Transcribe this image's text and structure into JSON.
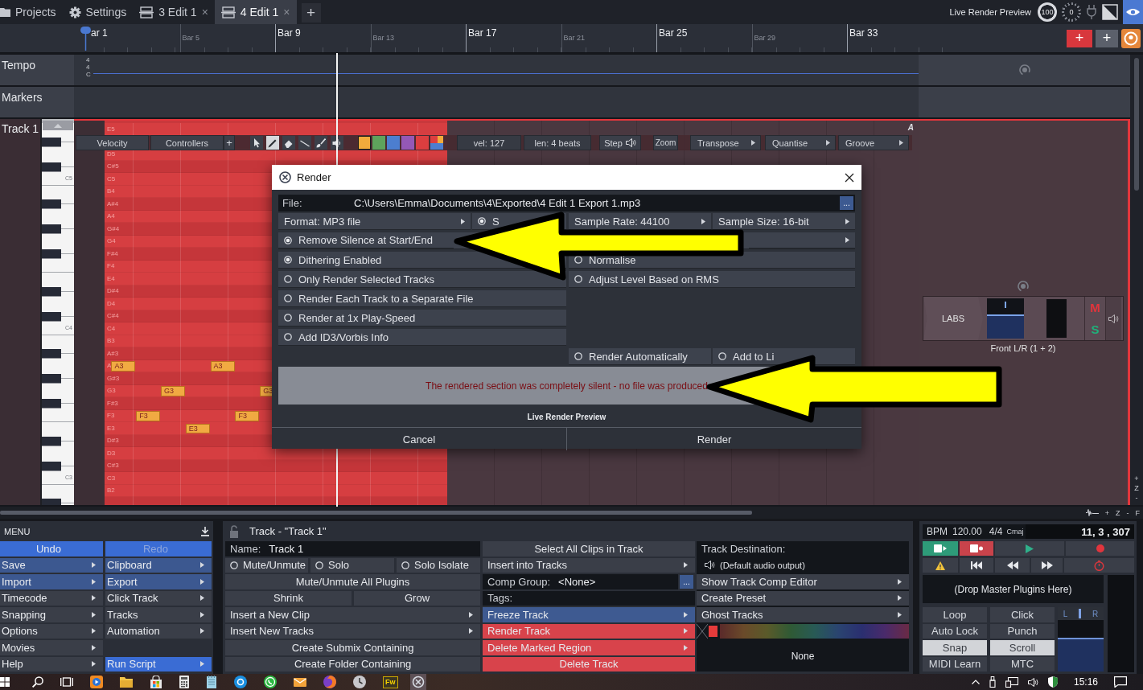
{
  "tabs": [
    {
      "kind": "folder",
      "label": "Projects",
      "selected": false
    },
    {
      "kind": "gear",
      "label": "Settings",
      "selected": false
    },
    {
      "kind": "edit",
      "label": "3 Edit 1",
      "close": "×",
      "selected": false
    },
    {
      "kind": "edit",
      "label": "4 Edit 1",
      "close": "×",
      "selected": true
    }
  ],
  "new_tab": "+",
  "live_render": {
    "label": "Live Render Preview",
    "knobs": [
      {
        "kind": "solid",
        "reading": "100"
      },
      {
        "kind": "dotted",
        "reading": "0"
      }
    ]
  },
  "ruler": {
    "bars": [
      {
        "label": "ar 1",
        "major": true
      },
      {
        "label": "Bar 5",
        "major": false
      },
      {
        "label": "Bar 9",
        "major": true
      },
      {
        "label": "Bar 13",
        "major": false
      },
      {
        "label": "Bar 17",
        "major": true
      },
      {
        "label": "Bar 21",
        "major": false
      },
      {
        "label": "Bar 25",
        "major": true
      },
      {
        "label": "Bar 29",
        "major": false
      },
      {
        "label": "Bar 33",
        "major": true
      }
    ],
    "buttons": [
      {
        "kind": "accent",
        "label": "+"
      },
      {
        "kind": "plain",
        "label": "+"
      }
    ]
  },
  "tempo_track": {
    "name": "Tempo",
    "signature": [
      "4",
      "4",
      "C"
    ]
  },
  "marker_track": {
    "name": "Markers"
  },
  "midi_track": {
    "name": "Track 1",
    "rows": [
      {
        "note": "E5",
        "black": false
      },
      {
        "black": true
      },
      {
        "note": "D5",
        "black": false
      },
      {
        "note": "C#5",
        "black": true
      },
      {
        "note": "C5",
        "black": false,
        "key_label": "C5"
      },
      {
        "note": "B4",
        "black": false
      },
      {
        "note": "A#4",
        "black": true
      },
      {
        "note": "A4",
        "black": false
      },
      {
        "note": "G#4",
        "black": true
      },
      {
        "note": "G4",
        "black": false
      },
      {
        "note": "F#4",
        "black": true
      },
      {
        "note": "F4",
        "black": false
      },
      {
        "note": "E4",
        "black": false
      },
      {
        "note": "D#4",
        "black": true
      },
      {
        "note": "D4",
        "black": false
      },
      {
        "note": "C#4",
        "black": true
      },
      {
        "note": "C4",
        "black": false,
        "key_label": "C4"
      },
      {
        "note": "B3",
        "black": false
      },
      {
        "note": "A#3",
        "black": true
      },
      {
        "note": "A",
        "black": false,
        "notes": [
          {
            "label": "A3"
          },
          {
            "label": "A3"
          }
        ]
      },
      {
        "note": "G#3",
        "black": true
      },
      {
        "note": "G3",
        "black": false,
        "notes": [
          {
            "label": "G3"
          },
          {
            "label": "G3"
          }
        ]
      },
      {
        "note": "F#3",
        "black": true
      },
      {
        "note": "F3",
        "black": false,
        "notes": [
          {
            "label": "F3"
          },
          {
            "label": "F3"
          }
        ]
      },
      {
        "note": "E3",
        "black": false,
        "notes": [
          {
            "label": "E3"
          }
        ]
      },
      {
        "note": "D#3",
        "black": true
      },
      {
        "note": "D3",
        "black": false
      },
      {
        "note": "C#3",
        "black": true
      },
      {
        "note": "C3",
        "black": false,
        "key_label": "C3"
      },
      {
        "note": "B2",
        "black": false
      },
      {
        "black": true
      }
    ],
    "toolbar": {
      "buttons": [
        "Velocity",
        "Controllers"
      ],
      "add": "+",
      "tools": [
        {
          "selected": false
        },
        {
          "selected": true
        },
        {
          "selected": false
        },
        {
          "selected": false
        },
        {
          "selected": false
        },
        {
          "selected": false
        }
      ],
      "swatches": [
        {
          "color": "#f2ab3c",
          "selected": true
        },
        {
          "color": "#5ea35c",
          "selected": false
        },
        {
          "color": "#4c7ecf",
          "selected": false
        },
        {
          "color": "#9458b6",
          "selected": false
        },
        {
          "color": "#dc3e3f",
          "selected": false
        },
        {
          "kind": "multi",
          "selected": false
        }
      ],
      "readouts": [
        "vel: 127",
        "len: 4 beats"
      ],
      "step": "Step",
      "zoom": "Zoom",
      "menus": [
        "Transpose",
        "Quantise",
        "Groove"
      ]
    },
    "corner": "A",
    "mixer": {
      "plugin": "LABS",
      "level": 0.6,
      "mute": "M",
      "solo": "S",
      "output": "Front L/R (1 + 2)"
    }
  },
  "zoom_controls": {
    "vertical": [
      "+",
      "Z",
      "-"
    ],
    "horizontal": [
      "+",
      "Z",
      "-",
      "F"
    ]
  },
  "render_dialog": {
    "title": "Render",
    "file_label": "File:",
    "file_path": "C:\\Users\\Emma\\Documents\\4\\Exported\\4 Edit 1 Export 1.mp3",
    "browse": "...",
    "rows": [
      {
        "left": [
          {
            "kind": "dropdown",
            "label": "Format: MP3 file"
          },
          {
            "kind": "radio",
            "label": "S",
            "checked": true
          }
        ],
        "right": [
          {
            "kind": "dropdown",
            "label": "Sample Rate: 44100"
          },
          {
            "kind": "dropdown",
            "label": "Sample Size: 16-bit"
          }
        ]
      },
      {
        "left": [
          {
            "kind": "radio",
            "label": "Remove Silence at Start/End",
            "checked": true
          }
        ],
        "right": [
          {
            "kind": "dropdown"
          }
        ]
      },
      {
        "left": [
          {
            "kind": "radio",
            "label": "Dithering Enabled",
            "checked": true
          }
        ],
        "right": [
          {
            "kind": "radio",
            "label": "Normalise",
            "checked": false
          }
        ]
      },
      {
        "left": [
          {
            "kind": "radio",
            "label": "Only Render Selected Tracks",
            "checked": false
          }
        ],
        "right": [
          {
            "kind": "radio",
            "label": "Adjust Level Based on RMS",
            "checked": false
          }
        ]
      },
      {
        "left": [
          {
            "kind": "radio",
            "label": "Render Each Track to a Separate File",
            "checked": false
          }
        ]
      },
      {
        "left": [
          {
            "kind": "radio",
            "label": "Render at 1x Play-Speed",
            "checked": false
          }
        ]
      },
      {
        "left": [
          {
            "kind": "radio",
            "label": "Add ID3/Vorbis Info",
            "checked": false
          }
        ]
      },
      {
        "right": [
          {
            "kind": "radio",
            "label": "Render Automatically",
            "checked": false
          },
          {
            "kind": "radio",
            "label": "Add to Li",
            "checked": false
          }
        ]
      }
    ],
    "message": "The rendered section was completely silent - no file was produced",
    "preview_label": "Live Render Preview",
    "buttons": [
      "Cancel",
      "Render"
    ]
  },
  "menu": {
    "title": "MENU",
    "items": [
      {
        "label": "Undo",
        "color": "#3a6cd4",
        "submenu": false,
        "disabled": false
      },
      {
        "label": "Redo",
        "color": "#3a6cd4",
        "submenu": false,
        "disabled": true
      },
      {
        "label": "Save",
        "color": "#3c5890",
        "submenu": true,
        "disabled": false
      },
      {
        "label": "Clipboard",
        "color": "#3c5890",
        "submenu": true,
        "disabled": false
      },
      {
        "label": "Import",
        "color": "#3c5890",
        "submenu": true,
        "disabled": false
      },
      {
        "label": "Export",
        "color": "#3c5890",
        "submenu": true,
        "disabled": false
      },
      {
        "label": "Timecode",
        "submenu": true,
        "disabled": false
      },
      {
        "label": "Click Track",
        "submenu": true,
        "disabled": false
      },
      {
        "label": "Snapping",
        "submenu": true,
        "disabled": false
      },
      {
        "label": "Tracks",
        "submenu": true,
        "disabled": false
      },
      {
        "label": "Options",
        "submenu": true,
        "disabled": false
      },
      {
        "label": "Automation",
        "submenu": true,
        "disabled": false
      },
      {
        "label": "Movies",
        "submenu": true,
        "disabled": false
      },
      {
        "kind": "empty"
      },
      {
        "label": "Help",
        "submenu": true,
        "disabled": false
      },
      {
        "label": "Run Script",
        "color": "#3a6cd4",
        "submenu": true,
        "disabled": false
      }
    ]
  },
  "track_panel": {
    "title": "Track - \"Track 1\"",
    "columns": [
      [
        {
          "kind": "field",
          "label": "Name:",
          "value": "Track 1"
        },
        {
          "kind": "radios",
          "items": [
            {
              "label": "Mute/Unmute",
              "checked": false
            },
            {
              "label": "Solo",
              "checked": false
            },
            {
              "label": "Solo Isolate",
              "checked": false
            }
          ]
        },
        {
          "kind": "button",
          "label": "Mute/Unmute All Plugins"
        },
        {
          "kind": "pair",
          "items": [
            "Shrink",
            "Grow"
          ]
        },
        {
          "kind": "menu",
          "label": "Insert a New Clip"
        },
        {
          "kind": "menu",
          "label": "Insert New Tracks"
        },
        {
          "kind": "button",
          "label": "Create Submix Containing"
        },
        {
          "kind": "button",
          "label": "Create Folder Containing"
        }
      ],
      [
        {
          "kind": "button",
          "label": "Select All Clips in Track"
        },
        {
          "kind": "menu",
          "label": "Insert into Tracks"
        },
        {
          "kind": "field",
          "label": "Comp Group:",
          "value": "<None>",
          "browse": "..."
        },
        {
          "kind": "field",
          "label": "Tags:"
        },
        {
          "kind": "menu",
          "label": "Freeze Track",
          "color": "#3e5a91"
        },
        {
          "kind": "menu",
          "label": "Render Track",
          "color": "#d8434b"
        },
        {
          "kind": "menu",
          "label": "Delete Marked Region",
          "color": "#d8434b"
        },
        {
          "kind": "button",
          "label": "Delete Track",
          "color": "#d8434b"
        }
      ],
      [
        {
          "kind": "heading",
          "label": "Track Destination:"
        },
        {
          "kind": "output",
          "label": "(Default audio output)"
        },
        {
          "kind": "menu",
          "label": "Show Track Comp Editor"
        },
        {
          "kind": "menu",
          "label": "Create Preset"
        },
        {
          "kind": "menu",
          "label": "Ghost Tracks"
        },
        {
          "kind": "colors",
          "color": "#e53b3b"
        },
        {
          "kind": "caption",
          "label": "None"
        }
      ]
    ]
  },
  "transport": {
    "bpm_label": "BPM",
    "bpm": "120.00",
    "signature": "4/4",
    "key": "Cmaj",
    "position": "11, 3 , 307",
    "control_rows": [
      [
        {
          "kind": "sync_play",
          "on": true
        },
        {
          "kind": "sync_record",
          "on": true
        },
        {
          "kind": "play",
          "on": false
        },
        {
          "kind": "record",
          "on": false
        }
      ],
      [
        {
          "kind": "warning",
          "on": false
        },
        {
          "kind": "to_start",
          "on": false
        },
        {
          "kind": "rewind",
          "on": false
        },
        {
          "kind": "forward",
          "on": false
        },
        {
          "kind": "timer",
          "on": false
        }
      ]
    ],
    "drop_zone": "(Drop Master Plugins Here)",
    "toggles": [
      {
        "label": "Loop",
        "on": false
      },
      {
        "label": "Click",
        "on": false
      },
      {
        "label": "Auto Lock",
        "on": false
      },
      {
        "label": "Punch",
        "on": false
      },
      {
        "label": "Snap",
        "on": true
      },
      {
        "label": "Scroll",
        "on": true
      },
      {
        "label": "MIDI Learn",
        "on": false
      },
      {
        "label": "MTC",
        "on": false
      }
    ],
    "master": {
      "left": "L",
      "right": "R",
      "level": 0.65
    }
  },
  "taskbar": {
    "app_badge": "Fw",
    "clock": "15:16"
  }
}
